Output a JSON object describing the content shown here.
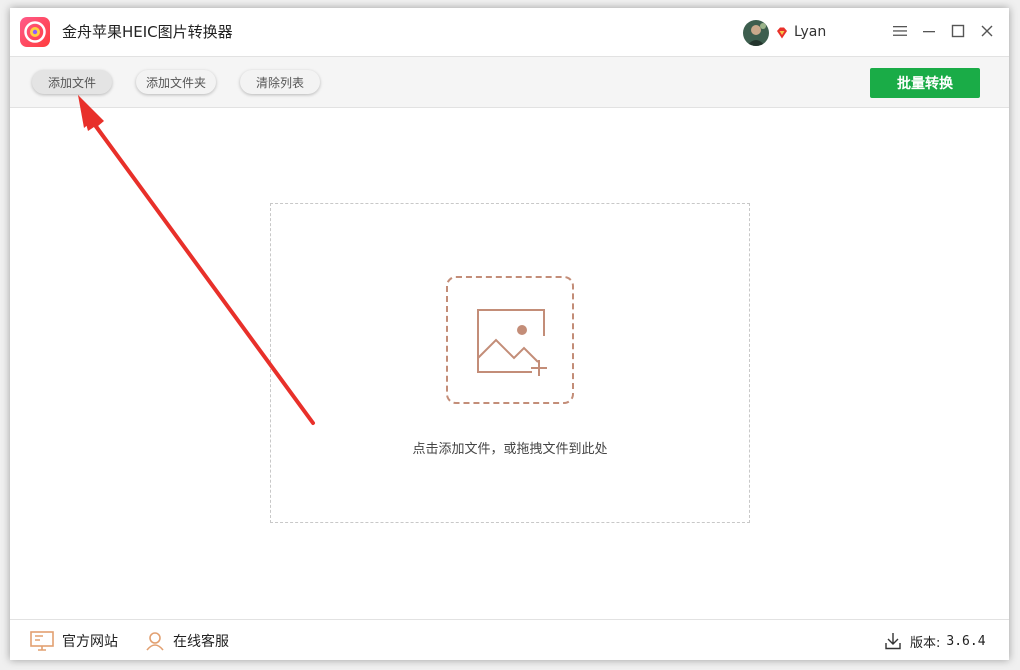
{
  "app": {
    "title": "金舟苹果HEIC图片转换器"
  },
  "user": {
    "name": "Lyan"
  },
  "toolbar": {
    "add_file": "添加文件",
    "add_folder": "添加文件夹",
    "clear_list": "清除列表",
    "batch_convert": "批量转换"
  },
  "dropzone": {
    "hint": "点击添加文件，或拖拽文件到此处"
  },
  "footer": {
    "website": "官方网站",
    "support": "在线客服",
    "version_label": "版本:",
    "version_value": "3.6.4"
  },
  "colors": {
    "accent_green": "#1aac47",
    "icon_brown": "#c38d78",
    "annotation_red": "#e8302a"
  },
  "icons": [
    "app-logo-icon",
    "vip-diamond-icon",
    "menu-icon",
    "minimize-icon",
    "maximize-icon",
    "close-icon",
    "image-add-icon",
    "monitor-icon",
    "headset-user-icon",
    "download-icon"
  ]
}
